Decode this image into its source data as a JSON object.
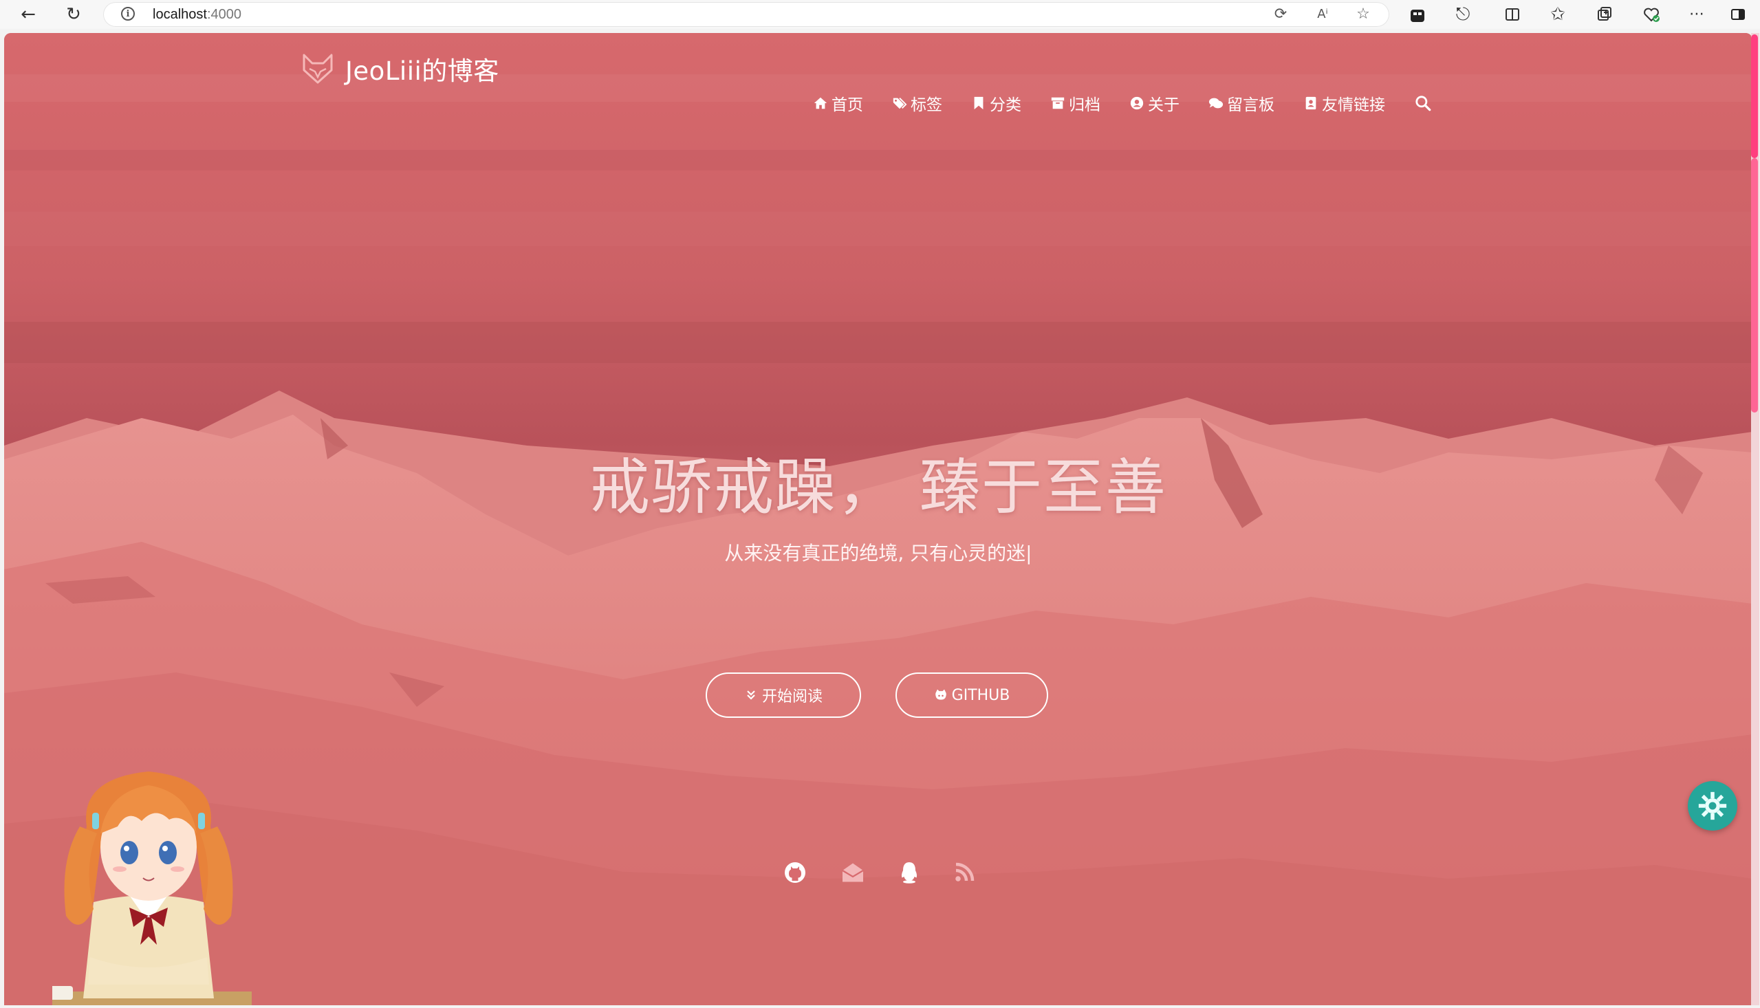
{
  "browser": {
    "url_host": "localhost",
    "url_port": ":4000"
  },
  "nav": {
    "brand": "JeoLiii的博客",
    "items": [
      {
        "icon": "home-icon",
        "label": "首页"
      },
      {
        "icon": "tags-icon",
        "label": "标签"
      },
      {
        "icon": "bookmark-icon",
        "label": "分类"
      },
      {
        "icon": "archive-icon",
        "label": "归档"
      },
      {
        "icon": "user-circle-icon",
        "label": "关于"
      },
      {
        "icon": "comments-icon",
        "label": "留言板"
      },
      {
        "icon": "address-book-icon",
        "label": "友情链接"
      }
    ],
    "search_icon": "search-icon"
  },
  "hero": {
    "title": "戒骄戒躁， 臻于至善",
    "subtitle": "从来没有真正的绝境, 只有心灵的迷|",
    "buttons": {
      "read": "开始阅读",
      "github": "GITHUB"
    }
  },
  "social": [
    "github-icon",
    "mail-icon",
    "qq-icon",
    "rss-icon"
  ],
  "colors": {
    "overlay": "#d86a6e",
    "accent_scroll": "#ff3f7f",
    "fab": "#26a69a"
  }
}
